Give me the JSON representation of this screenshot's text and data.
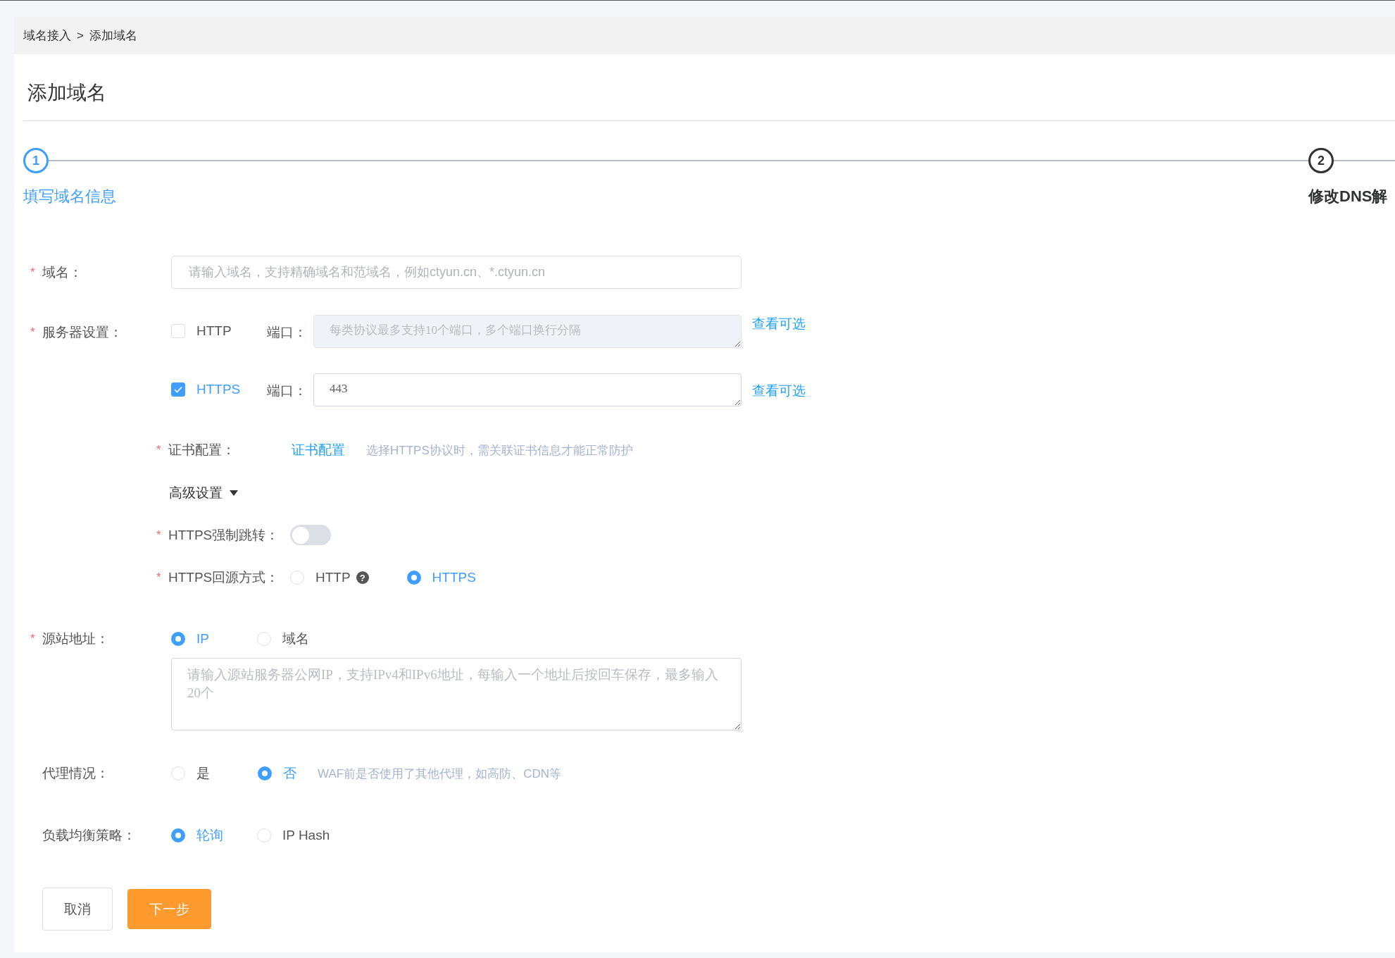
{
  "breadcrumb": {
    "items": [
      "域名接入",
      "添加域名"
    ],
    "separator": ">"
  },
  "title": "添加域名",
  "steps": [
    {
      "number": "1",
      "label": "填写域名信息",
      "selected": true
    },
    {
      "number": "2",
      "label": "修改DNS解",
      "selected": false
    }
  ],
  "domain": {
    "label": "域名：",
    "marker": "*",
    "placeholder": "请输入域名，支持精确域名和范域名，例如ctyun.cn、*.ctyun.cn"
  },
  "server": {
    "label": "服务器设置：",
    "marker": "*",
    "protocols": [
      {
        "label": "HTTP",
        "checked": false,
        "port_label": "端口：",
        "port_placeholder": "每类协议最多支持10个端口，多个端口换行分隔",
        "disabled": true,
        "link": "查看可选"
      },
      {
        "label": "HTTPS",
        "checked": true,
        "port_label": "端口：",
        "port_value": "443",
        "disabled": false,
        "link": "查看可选"
      }
    ]
  },
  "certificate": {
    "label": "证书配置：",
    "marker": "*",
    "link": "证书配置",
    "hint": "选择HTTPS协议时，需关联证书信息才能正常防护"
  },
  "advanced": {
    "label": "高级设置",
    "expanded": true
  },
  "force_redirect": {
    "label": "HTTPS强制跳转：",
    "marker": "*",
    "on": false
  },
  "origin_protocol": {
    "label": "HTTPS回源方式：",
    "marker": "*",
    "options": [
      {
        "label": "HTTP",
        "selected": false,
        "help": "?"
      },
      {
        "label": "HTTPS",
        "selected": true
      }
    ]
  },
  "origin_address": {
    "label": "源站地址：",
    "marker": "*",
    "options": [
      {
        "label": "IP",
        "selected": true
      },
      {
        "label": "域名",
        "selected": false
      }
    ],
    "placeholder": "请输入源站服务器公网IP，支持IPv4和IPv6地址，每输入一个地址后按回车保存，最多输入20个"
  },
  "proxy": {
    "label": "代理情况：",
    "options": [
      {
        "label": "是",
        "selected": false
      },
      {
        "label": "否",
        "selected": true
      }
    ],
    "hint": "WAF前是否使用了其他代理，如高防、CDN等"
  },
  "load_balance": {
    "label": "负载均衡策略：",
    "options": [
      {
        "label": "轮询",
        "selected": true
      },
      {
        "label": "IP Hash",
        "selected": false
      }
    ]
  },
  "buttons": [
    {
      "label": "取消",
      "kind": "secondary"
    },
    {
      "label": "下一步",
      "kind": "primary"
    }
  ]
}
